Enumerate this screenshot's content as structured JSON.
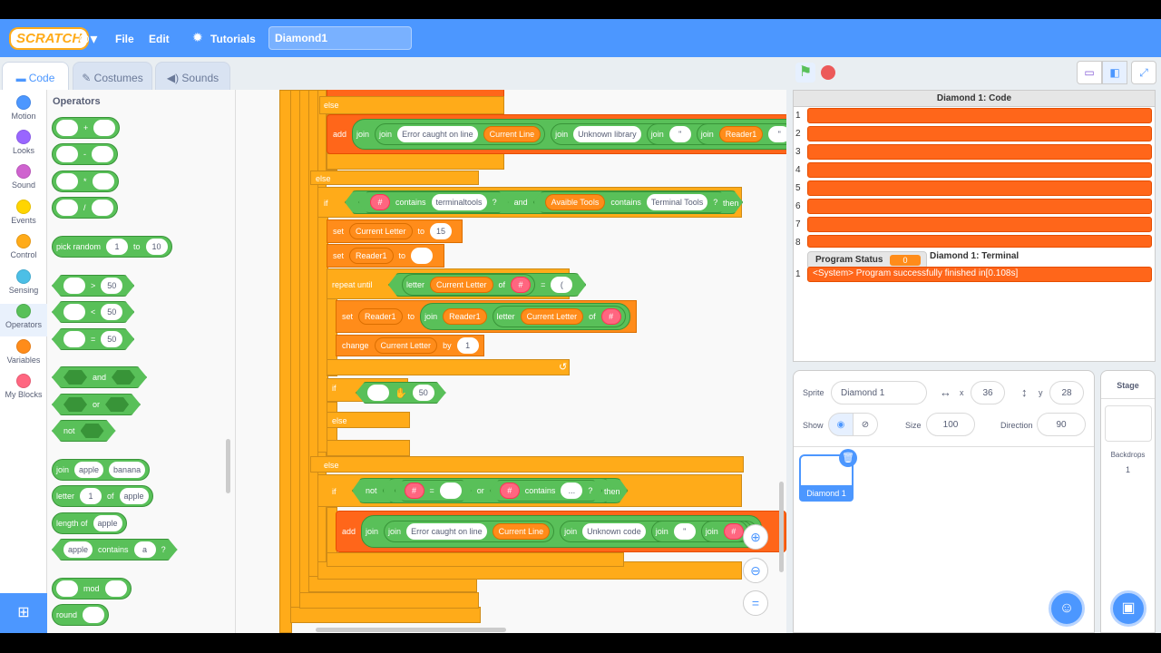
{
  "menubar": {
    "logo": "SCRATCH",
    "file": "File",
    "edit": "Edit",
    "tutorials": "Tutorials",
    "project_title": "Diamond1"
  },
  "tabs": {
    "code": "Code",
    "costumes": "Costumes",
    "sounds": "Sounds"
  },
  "categories": [
    {
      "label": "Motion",
      "color": "#4c97ff"
    },
    {
      "label": "Looks",
      "color": "#9966ff"
    },
    {
      "label": "Sound",
      "color": "#cf63cf"
    },
    {
      "label": "Events",
      "color": "#ffd500"
    },
    {
      "label": "Control",
      "color": "#ffab19"
    },
    {
      "label": "Sensing",
      "color": "#4cbfe6"
    },
    {
      "label": "Operators",
      "color": "#59c059"
    },
    {
      "label": "Variables",
      "color": "#ff8c1a"
    },
    {
      "label": "My Blocks",
      "color": "#ff6680"
    }
  ],
  "palette": {
    "heading": "Operators",
    "plus": "+",
    "minus": "-",
    "times": "*",
    "divide": "/",
    "pick_random": "pick random",
    "pr_a": "1",
    "pr_to": "to",
    "pr_b": "10",
    "gt": ">",
    "lt": "<",
    "eq": "=",
    "fifty": "50",
    "and": "and",
    "or": "or",
    "not": "not",
    "join": "join",
    "apple": "apple",
    "banana": "banana",
    "letter": "letter",
    "one": "1",
    "of": "of",
    "length_of": "length of",
    "contains": "contains",
    "a": "a",
    "q": "?",
    "mod": "mod",
    "round": "round"
  },
  "script": {
    "else1": "else",
    "else2": "else",
    "else3": "else",
    "else4": "else",
    "if1": "if",
    "if2": "if",
    "if3": "if",
    "add1": {
      "add": "add",
      "join": "join",
      "ecol": "Error caught on line",
      "cur_line": "Current Line",
      "unk_lib": "Unknown library",
      "quote": "\"",
      "reader1": "Reader1",
      "q2": "\""
    },
    "if_cond": {
      "hash": "#",
      "contains": "contains",
      "terminaltools": "terminaltools",
      "q": "?",
      "and": "and",
      "avail": "Avaible Tools",
      "contains2": "contains",
      "term_tools": "Terminal Tools",
      "then": "then"
    },
    "set1": {
      "set": "set",
      "var": "Current Letter",
      "to": "to",
      "val": "15"
    },
    "set2": {
      "set": "set",
      "var": "Reader1",
      "to": "to"
    },
    "repeat": {
      "label": "repeat until",
      "letter": "letter",
      "cur_letter": "Current Letter",
      "of": "of",
      "hash": "#",
      "eq": "=",
      "paren": "("
    },
    "set3": {
      "set": "set",
      "var": "Reader1",
      "to": "to",
      "join": "join",
      "reader1": "Reader1",
      "letter": "letter",
      "cur_letter": "Current Letter",
      "of": "of"
    },
    "change": {
      "change": "change",
      "var": "Current Letter",
      "by": "by",
      "val": "1"
    },
    "drag": {
      "fifty": "50"
    },
    "if3cond": {
      "not": "not",
      "hash": "#",
      "eq": "=",
      "or": "or",
      "contains": "contains",
      "dots": "...",
      "q": "?",
      "then": "then"
    },
    "add2": {
      "add": "add",
      "join": "join",
      "ecol": "Error caught on line",
      "cur_line": "Current Line",
      "unk_code": "Unknown code",
      "quote": "\"",
      "hash": "#"
    }
  },
  "stage": {
    "list_title": "Diamond 1: Code",
    "rows": [
      "1",
      "2",
      "3",
      "4",
      "5",
      "6",
      "7",
      "8"
    ],
    "status_label": "Program Status",
    "status_val": "0",
    "term_title": "Diamond 1: Terminal",
    "term_row": "1",
    "term_text": "<System> Program successfully finished in[0.108s]"
  },
  "sprite": {
    "sprite_label": "Sprite",
    "name": "Diamond 1",
    "x_label": "x",
    "x": "36",
    "y_label": "y",
    "y": "28",
    "show_label": "Show",
    "size_label": "Size",
    "size": "100",
    "dir_label": "Direction",
    "dir": "90",
    "thumb_name": "Diamond 1"
  },
  "stagepane": {
    "title": "Stage",
    "backdrops": "Backdrops",
    "count": "1"
  }
}
